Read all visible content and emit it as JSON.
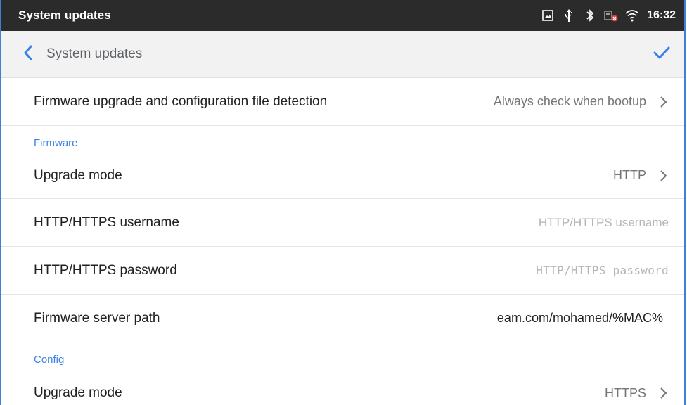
{
  "statusbar": {
    "title": "System updates",
    "time": "16:32",
    "icons": [
      "screenshot-icon",
      "usb-icon",
      "bluetooth-icon",
      "ethernet-disconnected-icon",
      "wifi-icon"
    ]
  },
  "actionbar": {
    "title": "System updates",
    "back_icon": "chevron-left-icon",
    "confirm_icon": "checkmark-icon"
  },
  "rows": {
    "detection": {
      "label": "Firmware upgrade and configuration file detection",
      "value": "Always check when bootup"
    },
    "firmware_section": "Firmware",
    "fw_upgrade_mode": {
      "label": "Upgrade mode",
      "value": "HTTP"
    },
    "http_username": {
      "label": "HTTP/HTTPS username",
      "placeholder": "HTTP/HTTPS username"
    },
    "http_password": {
      "label": "HTTP/HTTPS password",
      "placeholder": "HTTP/HTTPS password"
    },
    "fw_server_path": {
      "label": "Firmware server path",
      "value": "eam.com/mohamed/%MAC%"
    },
    "config_section": "Config",
    "cfg_upgrade_mode": {
      "label": "Upgrade mode",
      "value": "HTTPS"
    }
  },
  "colors": {
    "accent": "#3b82e6",
    "statusbar_bg": "#2b2b2b",
    "actionbar_bg": "#f2f2f2"
  }
}
